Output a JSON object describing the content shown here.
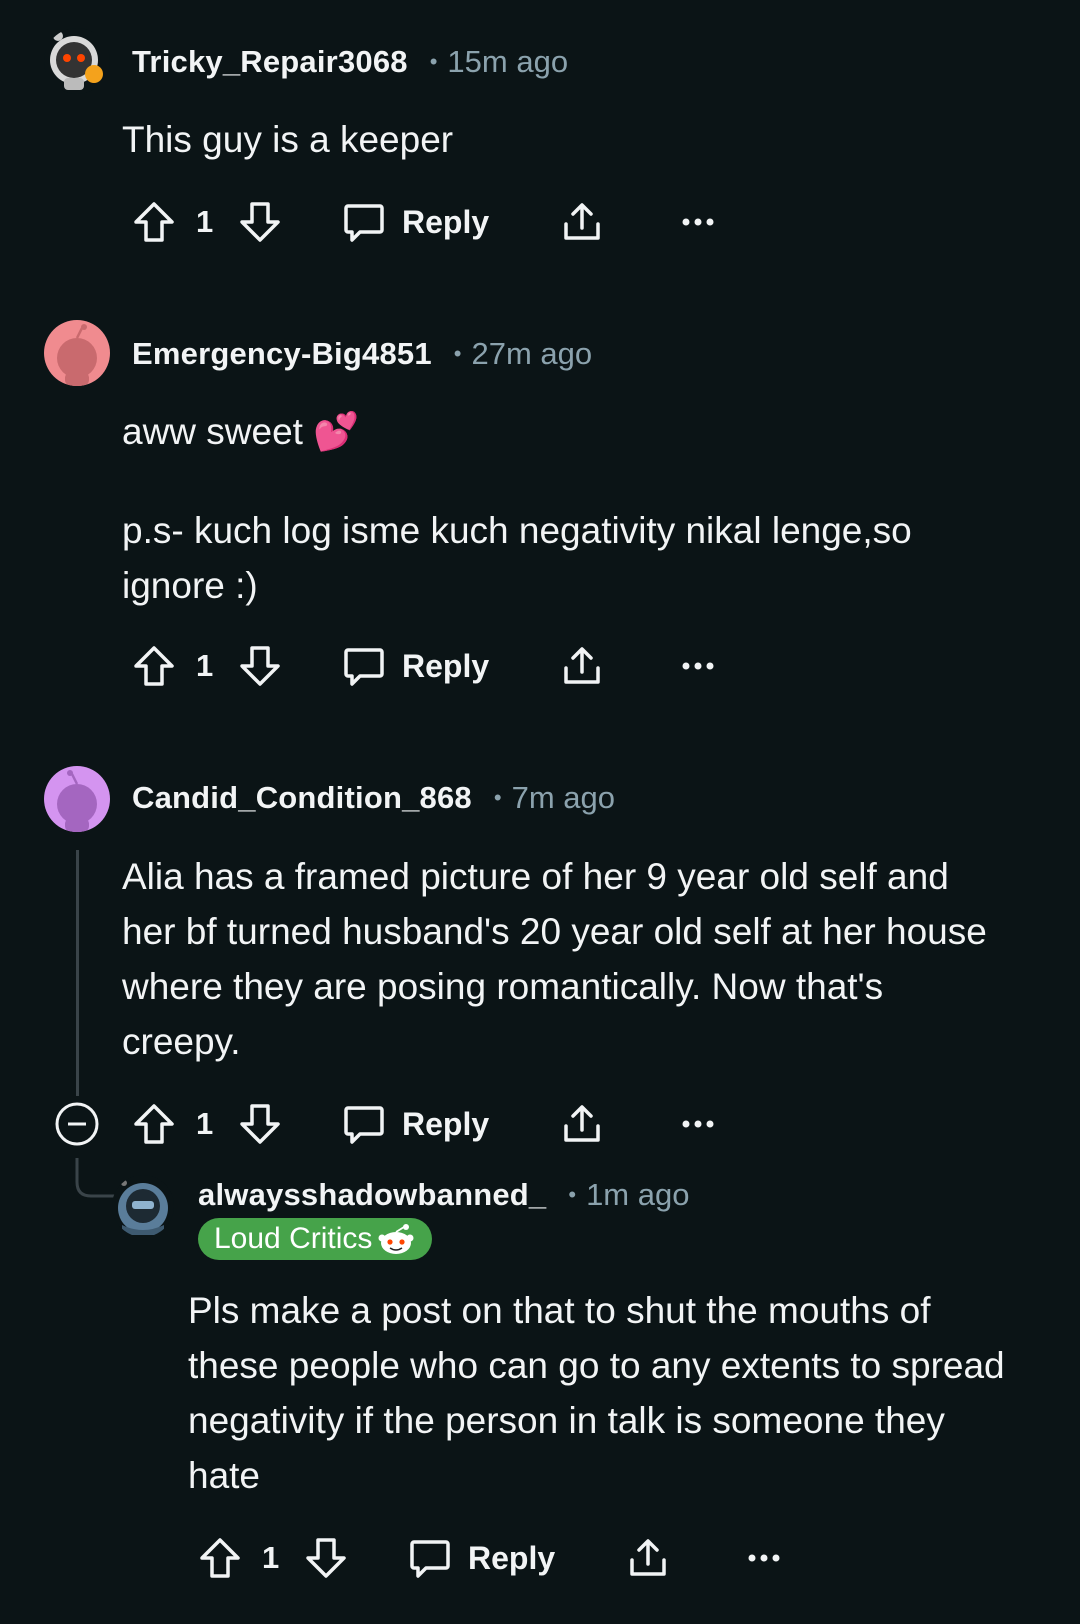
{
  "comments": [
    {
      "username": "Tricky_Repair3068",
      "time": "15m ago",
      "body": [
        "This guy is a keeper"
      ],
      "votes": "1",
      "reply_label": "Reply"
    },
    {
      "username": "Emergency-Big4851",
      "time": "27m ago",
      "body": [
        "aww sweet 💕",
        "p.s- kuch log isme kuch negativity nikal lenge,so ignore :)"
      ],
      "votes": "1",
      "reply_label": "Reply",
      "avatar_color": "#f08b8f"
    },
    {
      "username": "Candid_Condition_868",
      "time": "7m ago",
      "body": [
        "Alia has a framed picture of her 9 year old self and her bf turned husband's 20 year old self at her house where they are posing romantically. Now that's creepy."
      ],
      "votes": "1",
      "reply_label": "Reply",
      "avatar_color": "#d494f0"
    },
    {
      "username": "alwaysshadowbanned_",
      "time": "1m ago",
      "flair": "Loud Critics",
      "body": [
        "Pls make a post on that to shut the mouths of these people who can go to any extents to spread negativity if the person in talk is someone they hate"
      ],
      "votes": "1",
      "reply_label": "Reply"
    }
  ],
  "colors": {
    "background": "#0b1416",
    "text": "#f2f4f5",
    "meta": "#8ba2ad",
    "flair": "#46a34a"
  },
  "icons": [
    "upvote-icon",
    "downvote-icon",
    "comment-icon",
    "share-icon",
    "more-icon",
    "collapse-icon"
  ]
}
